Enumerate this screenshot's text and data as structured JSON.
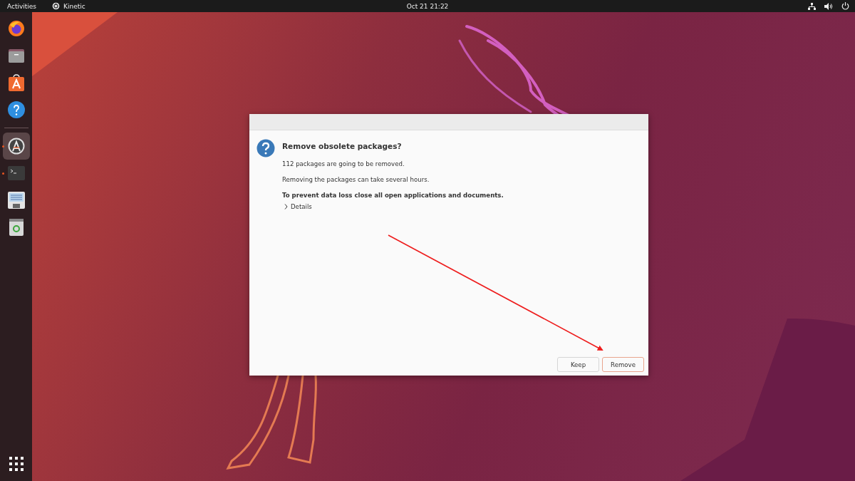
{
  "top_bar": {
    "activities": "Activities",
    "app_name": "Kinetic",
    "clock": "Oct 21  21:22"
  },
  "dock": {
    "items": [
      {
        "kind": "browser",
        "running": false,
        "selected": false
      },
      {
        "kind": "files",
        "running": false,
        "selected": false
      },
      {
        "kind": "store",
        "running": false,
        "selected": false
      },
      {
        "kind": "help",
        "running": false,
        "selected": false
      },
      {
        "kind": "separator"
      },
      {
        "kind": "updater",
        "running": true,
        "selected": true
      },
      {
        "kind": "terminal",
        "running": true,
        "selected": false
      },
      {
        "kind": "editor",
        "running": false,
        "selected": false
      },
      {
        "kind": "trash",
        "running": false,
        "selected": false
      }
    ]
  },
  "dialog": {
    "title": "Remove obsolete packages?",
    "messages": [
      {
        "text": "112 packages are going to be removed.",
        "kind": "normal"
      },
      {
        "text": "Removing the packages can take several hours.",
        "kind": "normal"
      },
      {
        "text": "To prevent data loss close all open applications and documents.",
        "kind": "bold"
      }
    ],
    "details": {
      "label": "Details",
      "expanded": false
    },
    "buttons": [
      {
        "label": "Keep",
        "default": false
      },
      {
        "label": "Remove",
        "default": true
      }
    ]
  }
}
